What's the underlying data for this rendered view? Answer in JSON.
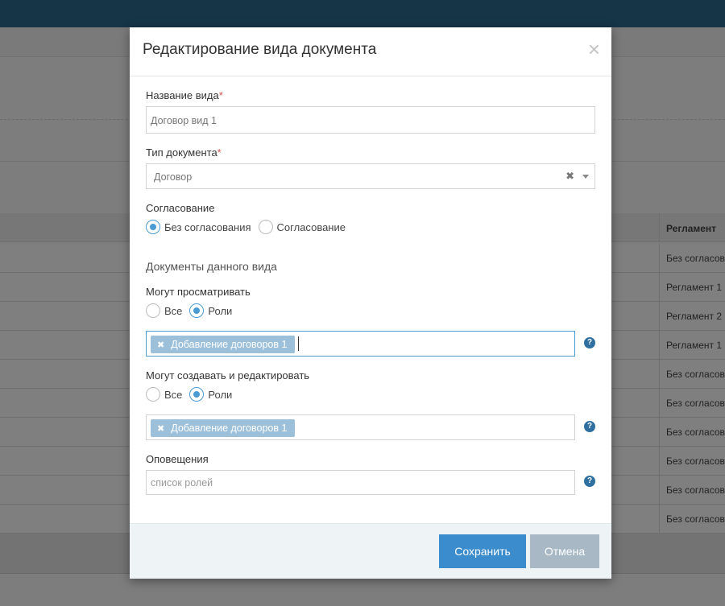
{
  "background": {
    "table": {
      "header": "Регламент",
      "rows": [
        "Без согласования",
        "Регламент 1",
        "Регламент 2",
        "Регламент 1",
        "Без согласования",
        "Без согласования",
        "Без согласования",
        "Без согласования",
        "Без согласования",
        "Без согласования"
      ]
    }
  },
  "modal": {
    "title": "Редактирование вида документа",
    "close_glyph": "×",
    "name_field": {
      "label": "Название вида",
      "required_mark": "*",
      "value": "Договор вид 1"
    },
    "doc_type": {
      "label": "Тип документа",
      "required_mark": "*",
      "value": "Договор",
      "clear_glyph": "✖"
    },
    "approval": {
      "label": "Согласование",
      "options": [
        "Без согласования",
        "Согласование"
      ],
      "selected": "Без согласования"
    },
    "section_title": "Документы данного вида",
    "can_view": {
      "label": "Могут просматривать",
      "options": [
        "Все",
        "Роли"
      ],
      "selected": "Роли",
      "tag": "Добавление договоров 1"
    },
    "can_edit": {
      "label": "Могут создавать и редактировать",
      "options": [
        "Все",
        "Роли"
      ],
      "selected": "Роли",
      "tag": "Добавление договоров 1"
    },
    "notifications": {
      "label": "Оповещения",
      "placeholder": "список ролей"
    },
    "help_glyph": "?",
    "tag_remove_glyph": "✖",
    "buttons": {
      "save": "Сохранить",
      "cancel": "Отмена"
    }
  },
  "colors": {
    "topbar": "#2c6a8e",
    "accent": "#3b8ccd",
    "tag": "#9cc0d9",
    "cancel": "#a8b8c4"
  }
}
